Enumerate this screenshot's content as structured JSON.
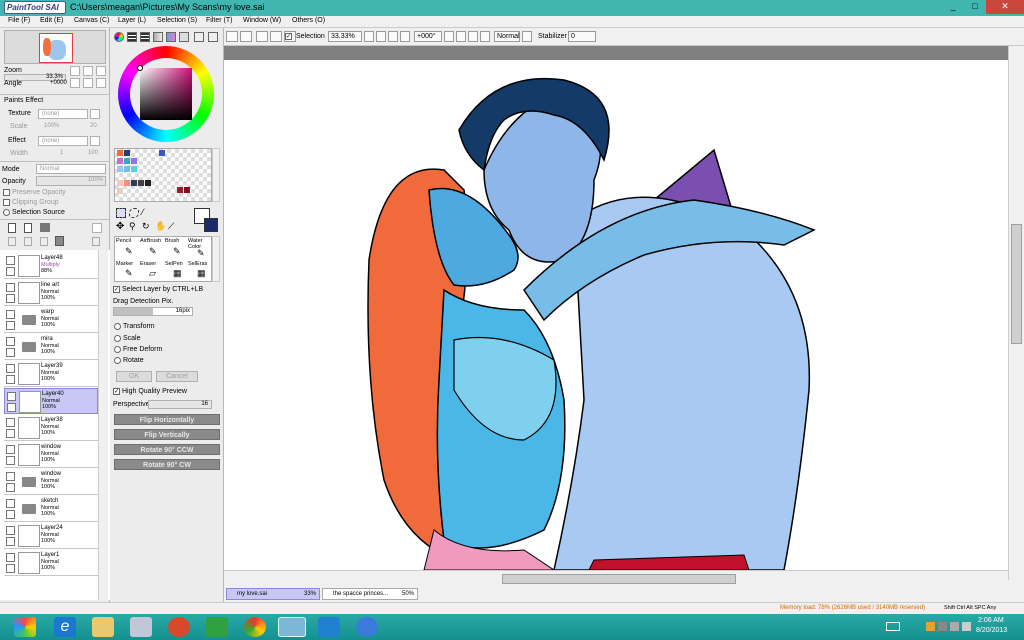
{
  "window": {
    "app_logo": "PaintTool SAI",
    "title": "C:\\Users\\meagan\\Pictures\\My Scans\\my love.sai",
    "min": "_",
    "max": "□",
    "close": "✕"
  },
  "menu": [
    "File (F)",
    "Edit (E)",
    "Canvas (C)",
    "Layer (L)",
    "Selection (S)",
    "Filter (T)",
    "Window (W)",
    "Others (O)"
  ],
  "toolbar": {
    "selection_label": "Selection",
    "zoom": "33.33%",
    "angle": "+000°",
    "mode": "Normal",
    "stabilizer_label": "Stabilizer",
    "stabilizer_value": "0"
  },
  "navigator": {
    "zoom_label": "Zoom",
    "zoom_value": "33.3%",
    "angle_label": "Angle",
    "angle_value": "+0000"
  },
  "paints_effect": {
    "header": "Paints Effect",
    "texture_label": "Texture",
    "texture_value": "(none)",
    "scale_label": "Scale",
    "scale_value": "100%",
    "scale_num": "20",
    "effect_label": "Effect",
    "effect_value": "(none)",
    "width_label": "Width",
    "width_value": "1",
    "width_num": "100"
  },
  "layer_props": {
    "mode_label": "Mode",
    "mode_value": "Normal",
    "opacity_label": "Opacity",
    "opacity_value": "100%",
    "preserve_opacity": "Preserve Opacity",
    "clipping_group": "Clipping Group",
    "selection_source": "Selection Source"
  },
  "layers": [
    {
      "name": "Layer48",
      "mode": "Multiply",
      "opacity": "88%",
      "folder": false,
      "selected": false,
      "mode_color": "#b040b0"
    },
    {
      "name": "line art",
      "mode": "Normal",
      "opacity": "100%",
      "folder": false,
      "selected": false
    },
    {
      "name": "warp",
      "mode": "Normal",
      "opacity": "100%",
      "folder": true,
      "selected": false
    },
    {
      "name": "mira",
      "mode": "Normal",
      "opacity": "100%",
      "folder": true,
      "selected": false
    },
    {
      "name": "Layer39",
      "mode": "Normal",
      "opacity": "100%",
      "folder": false,
      "selected": false
    },
    {
      "name": "Layer40",
      "mode": "Normal",
      "opacity": "100%",
      "folder": false,
      "selected": true
    },
    {
      "name": "Layer38",
      "mode": "Normal",
      "opacity": "100%",
      "folder": false,
      "selected": false
    },
    {
      "name": "window",
      "mode": "Normal",
      "opacity": "100%",
      "folder": false,
      "selected": false
    },
    {
      "name": "window",
      "mode": "Normal",
      "opacity": "100%",
      "folder": true,
      "selected": false
    },
    {
      "name": "sketch",
      "mode": "Normal",
      "opacity": "100%",
      "folder": true,
      "selected": false
    },
    {
      "name": "Layer24",
      "mode": "Normal",
      "opacity": "100%",
      "folder": false,
      "selected": false
    },
    {
      "name": "Layer1",
      "mode": "Normal",
      "opacity": "100%",
      "folder": false,
      "selected": false
    }
  ],
  "tools": {
    "row1": [
      "Pencil",
      "AirBrush",
      "Brush",
      "Water Color"
    ],
    "row2": [
      "Marker",
      "Eraser",
      "SelPen",
      "SelEras"
    ]
  },
  "tool_options": {
    "select_layer": "Select Layer by CTRL+LB",
    "drag_detection": "Drag Detection Pix.",
    "drag_value": "16pix",
    "transform": "Transform",
    "scale": "Scale",
    "free_deform": "Free Deform",
    "rotate": "Rotate",
    "ok": "OK",
    "cancel": "Cancel",
    "hq_preview": "High Quality Preview",
    "perspective_label": "Perspective",
    "perspective_value": "16",
    "flip_h": "Flip Horizontally",
    "flip_v": "Flip Vertically",
    "rot_ccw": "Rotate 90° CCW",
    "rot_cw": "Rotate 90° CW"
  },
  "docs": [
    {
      "name": "my love.sai",
      "zoom": "33%"
    },
    {
      "name": "the spacce princes...",
      "zoom": "50%"
    }
  ],
  "status": {
    "memory": "Memory load: 78% (2626MB used / 3140MB reserved)",
    "keys": "Shift Ctrl Alt SPC Any"
  },
  "taskbar": {
    "time": "2:06 AM",
    "date": "8/20/2013"
  },
  "colors": {
    "title_bar": "#3fb7b0",
    "selected_layer": "#c9c8f4",
    "taskbar": "#1a9c99"
  }
}
